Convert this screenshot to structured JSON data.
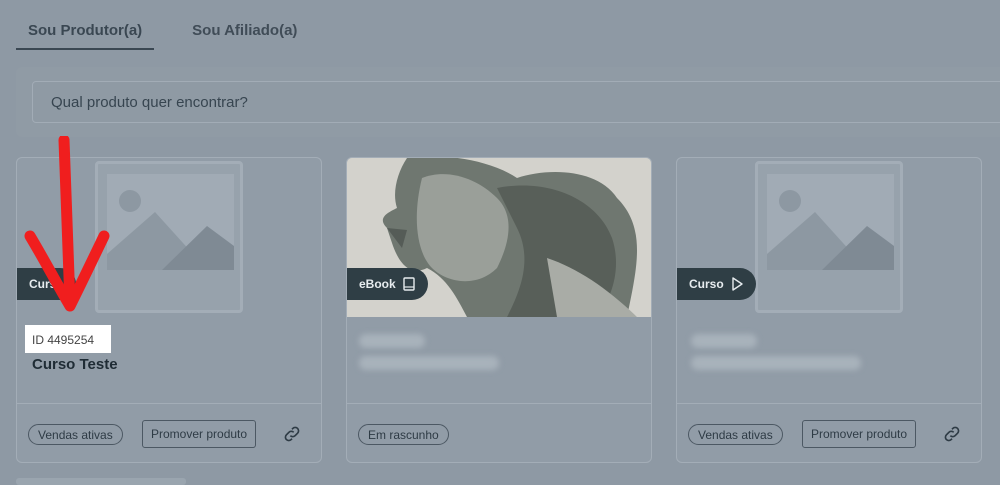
{
  "tabs": [
    {
      "label": "Sou Produtor(a)",
      "active": true
    },
    {
      "label": "Sou Afiliado(a)",
      "active": false
    }
  ],
  "search": {
    "placeholder": "Qual produto quer encontrar?"
  },
  "cards": [
    {
      "badge": "Curso",
      "product_id": "ID 4495254",
      "title": "Curso Teste",
      "status": "Vendas ativas",
      "promote_label": "Promover produto"
    },
    {
      "badge": "eBook",
      "status": "Em rascunho"
    },
    {
      "badge": "Curso",
      "status": "Vendas ativas",
      "promote_label": "Promover produto"
    }
  ],
  "colors": {
    "overlay": "#8e99a4",
    "badge_bg": "#2f3e45",
    "annotation_arrow": "#f01e1e",
    "highlight_box": "#ffffff"
  },
  "icons": [
    "image-placeholder-icon",
    "book-icon",
    "play-icon",
    "link-icon",
    "annotation-arrow"
  ]
}
